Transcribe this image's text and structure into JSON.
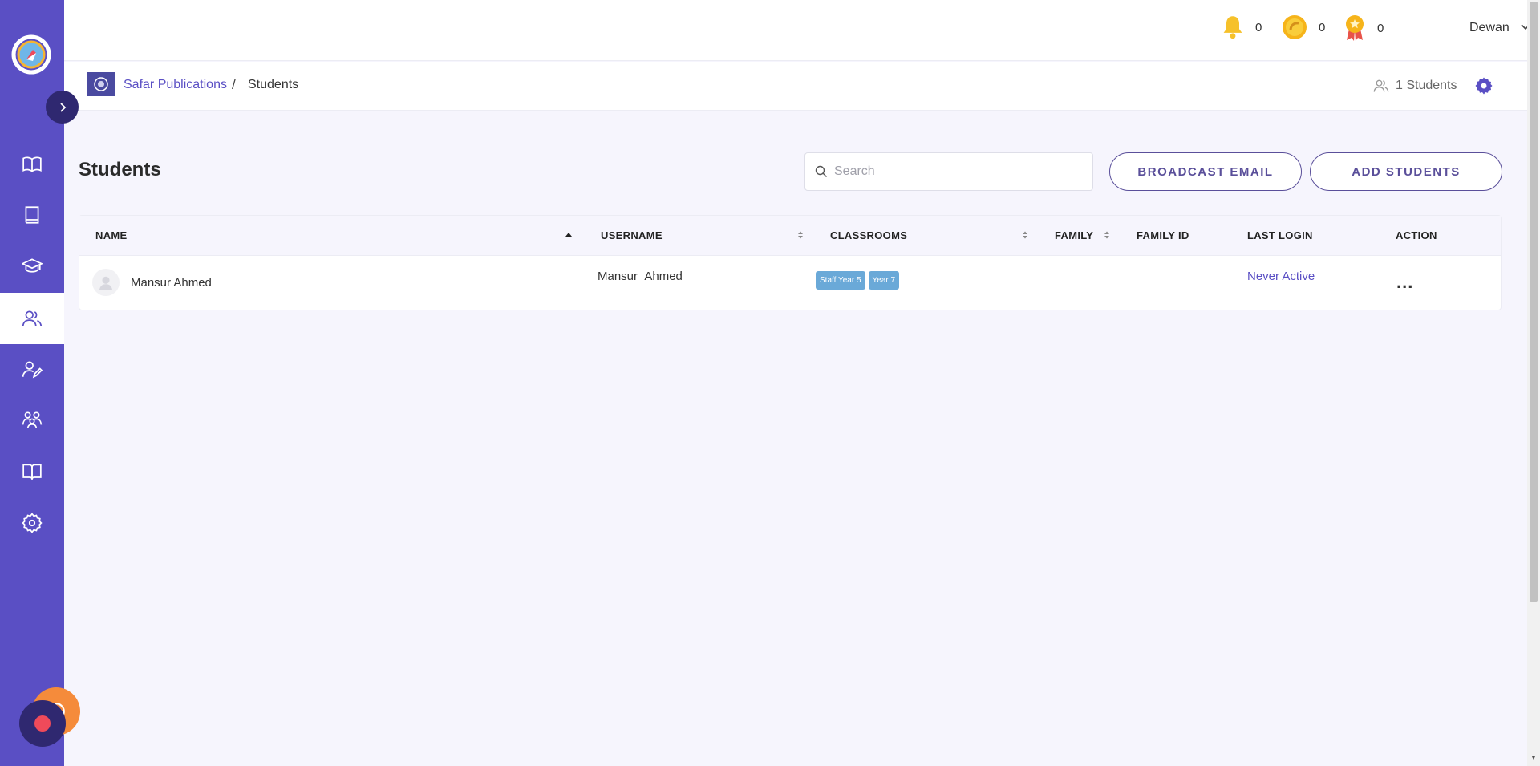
{
  "topbar": {
    "notifications_count": "0",
    "coins_count": "0",
    "awards_count": "0",
    "user_name": "Dewan"
  },
  "breadcrumb": {
    "org": "Safar Publications",
    "separator": "/",
    "current": "Students"
  },
  "summary": {
    "student_count": "1 Students"
  },
  "page": {
    "title": "Students",
    "search_placeholder": "Search",
    "broadcast_label": "BROADCAST EMAIL",
    "add_label": "ADD STUDENTS"
  },
  "table": {
    "columns": [
      "NAME",
      "USERNAME",
      "CLASSROOMS",
      "FAMILY",
      "FAMILY ID",
      "LAST LOGIN",
      "ACTION"
    ],
    "rows": [
      {
        "name": "Mansur Ahmed",
        "username": "Mansur_Ahmed",
        "classrooms": [
          "Staff Year 5",
          "Year 7"
        ],
        "family": "",
        "family_id": "",
        "last_login": "Never Active",
        "action": "..."
      }
    ]
  },
  "sidebar": {
    "items": [
      {
        "icon": "book-open-icon"
      },
      {
        "icon": "book-icon"
      },
      {
        "icon": "graduation-cap-icon"
      },
      {
        "icon": "users-icon",
        "active": true
      },
      {
        "icon": "user-edit-icon"
      },
      {
        "icon": "family-icon"
      },
      {
        "icon": "library-icon"
      },
      {
        "icon": "gear-icon"
      }
    ]
  },
  "colors": {
    "sidebar": "#5a4fc4",
    "accent": "#5a4fc4",
    "chip": "#6aa9d8",
    "record": "#ef4a5a",
    "help": "#f58b3b"
  }
}
